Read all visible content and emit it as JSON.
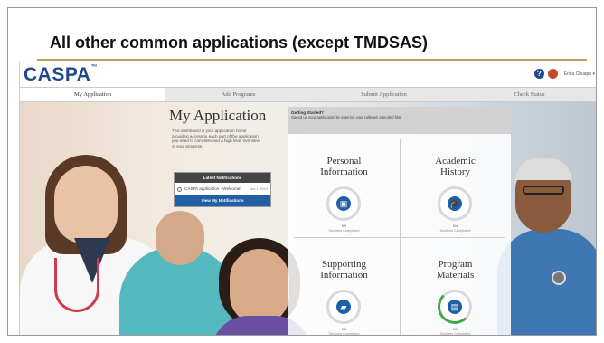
{
  "slide": {
    "title": "All other common applications (except TMDSAS)"
  },
  "header": {
    "logo": "CASPA",
    "logo_mark": "™",
    "help": "?",
    "user_name": "Erica Chuapo ▾"
  },
  "nav": {
    "tabs": [
      "My Application",
      "Add Programs",
      "Submit Application",
      "Check Status"
    ]
  },
  "intro": {
    "title": "My Application",
    "text": "This dashboard is your application home providing access to each part of the application you need to complete and a high level overview of your progress."
  },
  "notifications": {
    "header": "Latest Notifications",
    "item": "CASPA application - Welcome!",
    "date": "Mar 1, 2019",
    "button": "View My Notifications"
  },
  "getting_started": {
    "title": "Getting Started?",
    "text": "Speed up your application by entering your colleges attended first."
  },
  "tiles": [
    {
      "title_line1": "Personal",
      "title_line2": "Information",
      "count": "0/9",
      "sub": "Sections Completed",
      "icon": "id-card-icon",
      "glyph": "▣"
    },
    {
      "title_line1": "Academic",
      "title_line2": "History",
      "count": "0/4",
      "sub": "Sections Completed",
      "icon": "graduation-cap-icon",
      "glyph": "🎓"
    },
    {
      "title_line1": "Supporting",
      "title_line2": "Information",
      "count": "0/6",
      "sub": "Sections Completed",
      "icon": "folder-icon",
      "glyph": "▰"
    },
    {
      "title_line1": "Program",
      "title_line2": "Materials",
      "count": "0/0",
      "sub": "Sections Completed",
      "icon": "book-icon",
      "glyph": "▤"
    }
  ]
}
